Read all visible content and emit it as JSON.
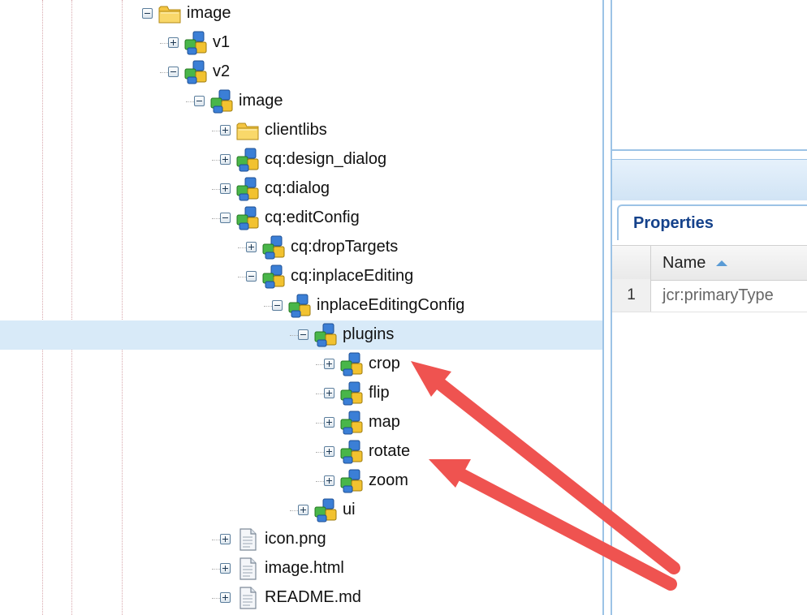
{
  "tree": {
    "nodes": [
      {
        "label": "image",
        "expanded": true,
        "icon": "folder-icon",
        "level": 0
      },
      {
        "label": "v1",
        "expanded": false,
        "icon": "component-node-icon",
        "level": 1
      },
      {
        "label": "v2",
        "expanded": true,
        "icon": "component-node-icon",
        "level": 1
      },
      {
        "label": "image",
        "expanded": true,
        "icon": "component-node-icon",
        "level": 2
      },
      {
        "label": "clientlibs",
        "expanded": false,
        "icon": "folder-icon",
        "level": 3
      },
      {
        "label": "cq:design_dialog",
        "expanded": false,
        "icon": "component-node-icon",
        "level": 3
      },
      {
        "label": "cq:dialog",
        "expanded": false,
        "icon": "component-node-icon",
        "level": 3
      },
      {
        "label": "cq:editConfig",
        "expanded": true,
        "icon": "component-node-icon",
        "level": 3
      },
      {
        "label": "cq:dropTargets",
        "expanded": false,
        "icon": "component-node-icon",
        "level": 4
      },
      {
        "label": "cq:inplaceEditing",
        "expanded": true,
        "icon": "component-node-icon",
        "level": 4
      },
      {
        "label": "inplaceEditingConfig",
        "expanded": true,
        "icon": "component-node-icon",
        "level": 5
      },
      {
        "label": "plugins",
        "expanded": true,
        "icon": "component-node-icon",
        "level": 6,
        "selected": true
      },
      {
        "label": "crop",
        "expanded": false,
        "icon": "component-node-icon",
        "level": 7
      },
      {
        "label": "flip",
        "expanded": false,
        "icon": "component-node-icon",
        "level": 7
      },
      {
        "label": "map",
        "expanded": false,
        "icon": "component-node-icon",
        "level": 7
      },
      {
        "label": "rotate",
        "expanded": false,
        "icon": "component-node-icon",
        "level": 7
      },
      {
        "label": "zoom",
        "expanded": false,
        "icon": "component-node-icon",
        "level": 7
      },
      {
        "label": "ui",
        "expanded": false,
        "icon": "component-node-icon",
        "level": 6
      },
      {
        "label": "icon.png",
        "expanded": false,
        "icon": "file-icon",
        "level": 3
      },
      {
        "label": "image.html",
        "expanded": false,
        "icon": "file-icon",
        "level": 3
      },
      {
        "label": "README.md",
        "expanded": false,
        "icon": "file-icon",
        "level": 3
      }
    ]
  },
  "properties_panel": {
    "tab_label": "Properties",
    "columns": {
      "name_header": "Name"
    },
    "rows": [
      {
        "num": "1",
        "name": "jcr:primaryType"
      }
    ]
  },
  "colors": {
    "selection": "#d8eaf8",
    "accent": "#15428b",
    "annotation_arrow": "#ef5350"
  }
}
